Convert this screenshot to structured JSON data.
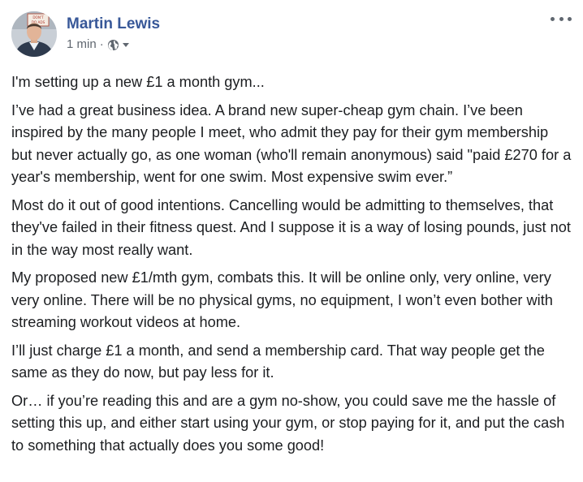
{
  "post": {
    "author": "Martin Lewis",
    "time": "1 min",
    "separator": "·",
    "privacy_icon": "globe-icon",
    "more_icon": "more-options-icon",
    "avatar_sign_text": "DON'T DO ADS",
    "paragraphs": [
      "I'm setting up a new £1 a month gym...",
      "I’ve had a great business idea. A brand new super-cheap gym chain. I’ve been inspired by the many people I meet, who admit they pay for their gym membership but never actually go, as one woman (who'll remain anonymous) said \"paid £270 for a year's membership, went for one swim. Most expensive swim ever.”",
      "Most do it out of good intentions. Cancelling would be admitting to themselves, that they've failed in their fitness quest. And I suppose it is a way of losing pounds, just not in the way most really want.",
      "My proposed new £1/mth gym, combats this. It will be online only, very online, very very online. There will be no physical gyms, no equipment, I won’t even bother with streaming workout videos at home.",
      "I’ll just charge £1 a month, and send a membership card. That way people get the same as they do now, but pay less for it.",
      "Or… if you’re reading this and are a gym no-show, you could save me the hassle of setting this up, and either start using your gym, or stop paying for it, and put the cash to something that actually does you some good!"
    ]
  },
  "colors": {
    "author": "#385898",
    "meta": "#606770",
    "text": "#1c1e21",
    "background": "#ffffff"
  }
}
